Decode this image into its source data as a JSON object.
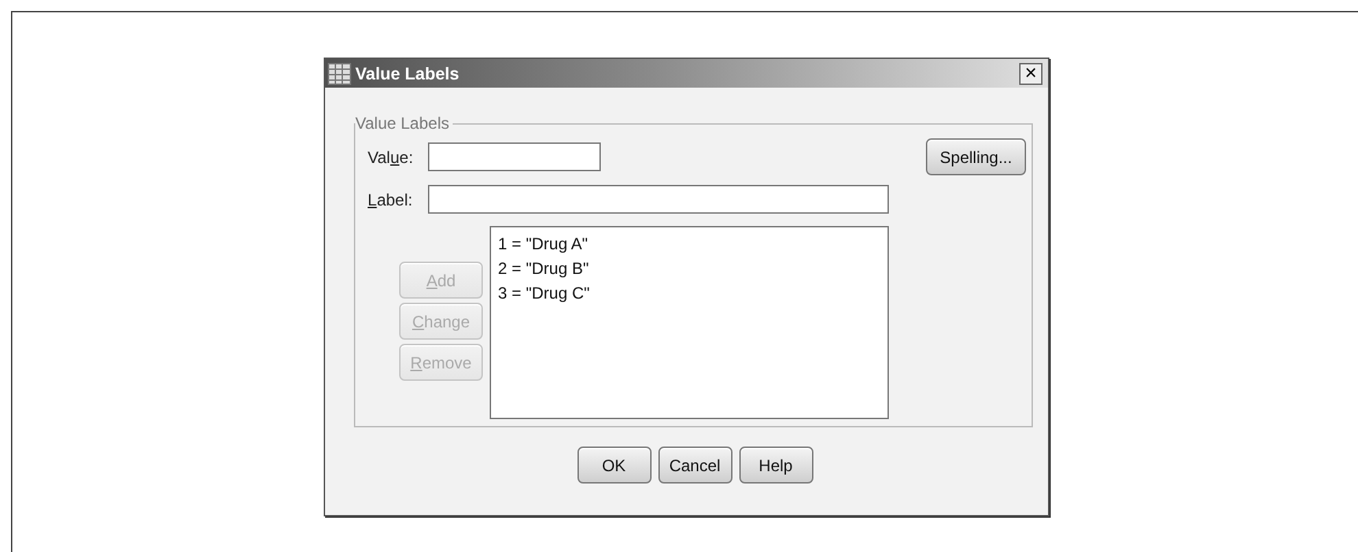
{
  "window": {
    "title": "Value Labels",
    "close": "×"
  },
  "group": {
    "title": "Value Labels"
  },
  "value_field": {
    "label": {
      "before": "Val",
      "access_key": "u",
      "after": "e:"
    }
  },
  "label_field": {
    "label": {
      "access_key": "L",
      "after": "abel:"
    }
  },
  "spelling_button": {
    "text": "Spelling...",
    "disabled": false
  },
  "list_buttons": [
    {
      "access_key": "A",
      "after": "dd",
      "disabled": true
    },
    {
      "access_key": "C",
      "after": "hange",
      "disabled": true
    },
    {
      "access_key": "R",
      "after": "emove",
      "disabled": true
    }
  ],
  "labels_list": [
    {
      "text": "1 = \"Drug A\"",
      "selected": false
    },
    {
      "text": "2 = \"Drug B\"",
      "selected": false
    },
    {
      "text": "3 = \"Drug C\"",
      "selected": false
    }
  ],
  "buttons": [
    {
      "text": "OK",
      "disabled": false
    },
    {
      "text": "Cancel",
      "disabled": false
    },
    {
      "text": "Help",
      "disabled": false
    }
  ]
}
